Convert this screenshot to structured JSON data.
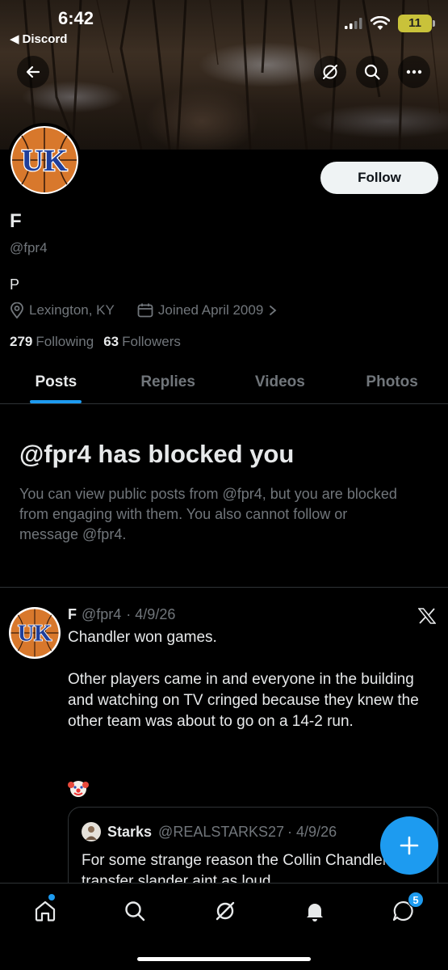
{
  "status_bar": {
    "time": "6:42",
    "back_app": "Discord",
    "battery": "11"
  },
  "profile": {
    "display_name": "F",
    "handle": "@fpr4",
    "bio": "P",
    "location": "Lexington, KY",
    "joined": "Joined April 2009",
    "following_count": "279",
    "following_label": "Following",
    "followers_count": "63",
    "followers_label": "Followers",
    "follow_button": "Follow"
  },
  "tabs": [
    {
      "label": "Posts",
      "active": true
    },
    {
      "label": "Replies",
      "active": false
    },
    {
      "label": "Videos",
      "active": false
    },
    {
      "label": "Photos",
      "active": false
    }
  ],
  "blocked": {
    "title": "@fpr4 has blocked you",
    "message": "You can view public posts from @fpr4, but you are blocked from engaging with them. You also cannot follow or message @fpr4."
  },
  "post": {
    "name": "F",
    "handle": "@fpr4",
    "date": "· 4/9/26",
    "paragraphs": [
      "Chandler won games.",
      "Other players came in and everyone in the building and watching on TV cringed because they knew the other team was about to go on a 14-2 run."
    ],
    "emoji": "clown-face",
    "quote": {
      "name": "Starks",
      "handle": "@REALSTARKS27",
      "date": "· 4/9/26",
      "text": "For some strange reason the Collin Chandler transfer slander aint as loud"
    }
  },
  "bottom_nav": {
    "messages_badge": "5"
  },
  "colors": {
    "accent": "#1d9bf0",
    "background": "#000000",
    "muted": "#71767b",
    "text": "#e7e9ea",
    "uk_orange": "#d8782c",
    "uk_blue": "#1f3f9b"
  },
  "icons": [
    "back-arrow-icon",
    "grok-icon",
    "search-icon",
    "more-icon",
    "location-icon",
    "calendar-icon",
    "chevron-right-icon",
    "x-logo-icon",
    "plus-icon",
    "home-icon",
    "notifications-icon",
    "messages-icon"
  ]
}
